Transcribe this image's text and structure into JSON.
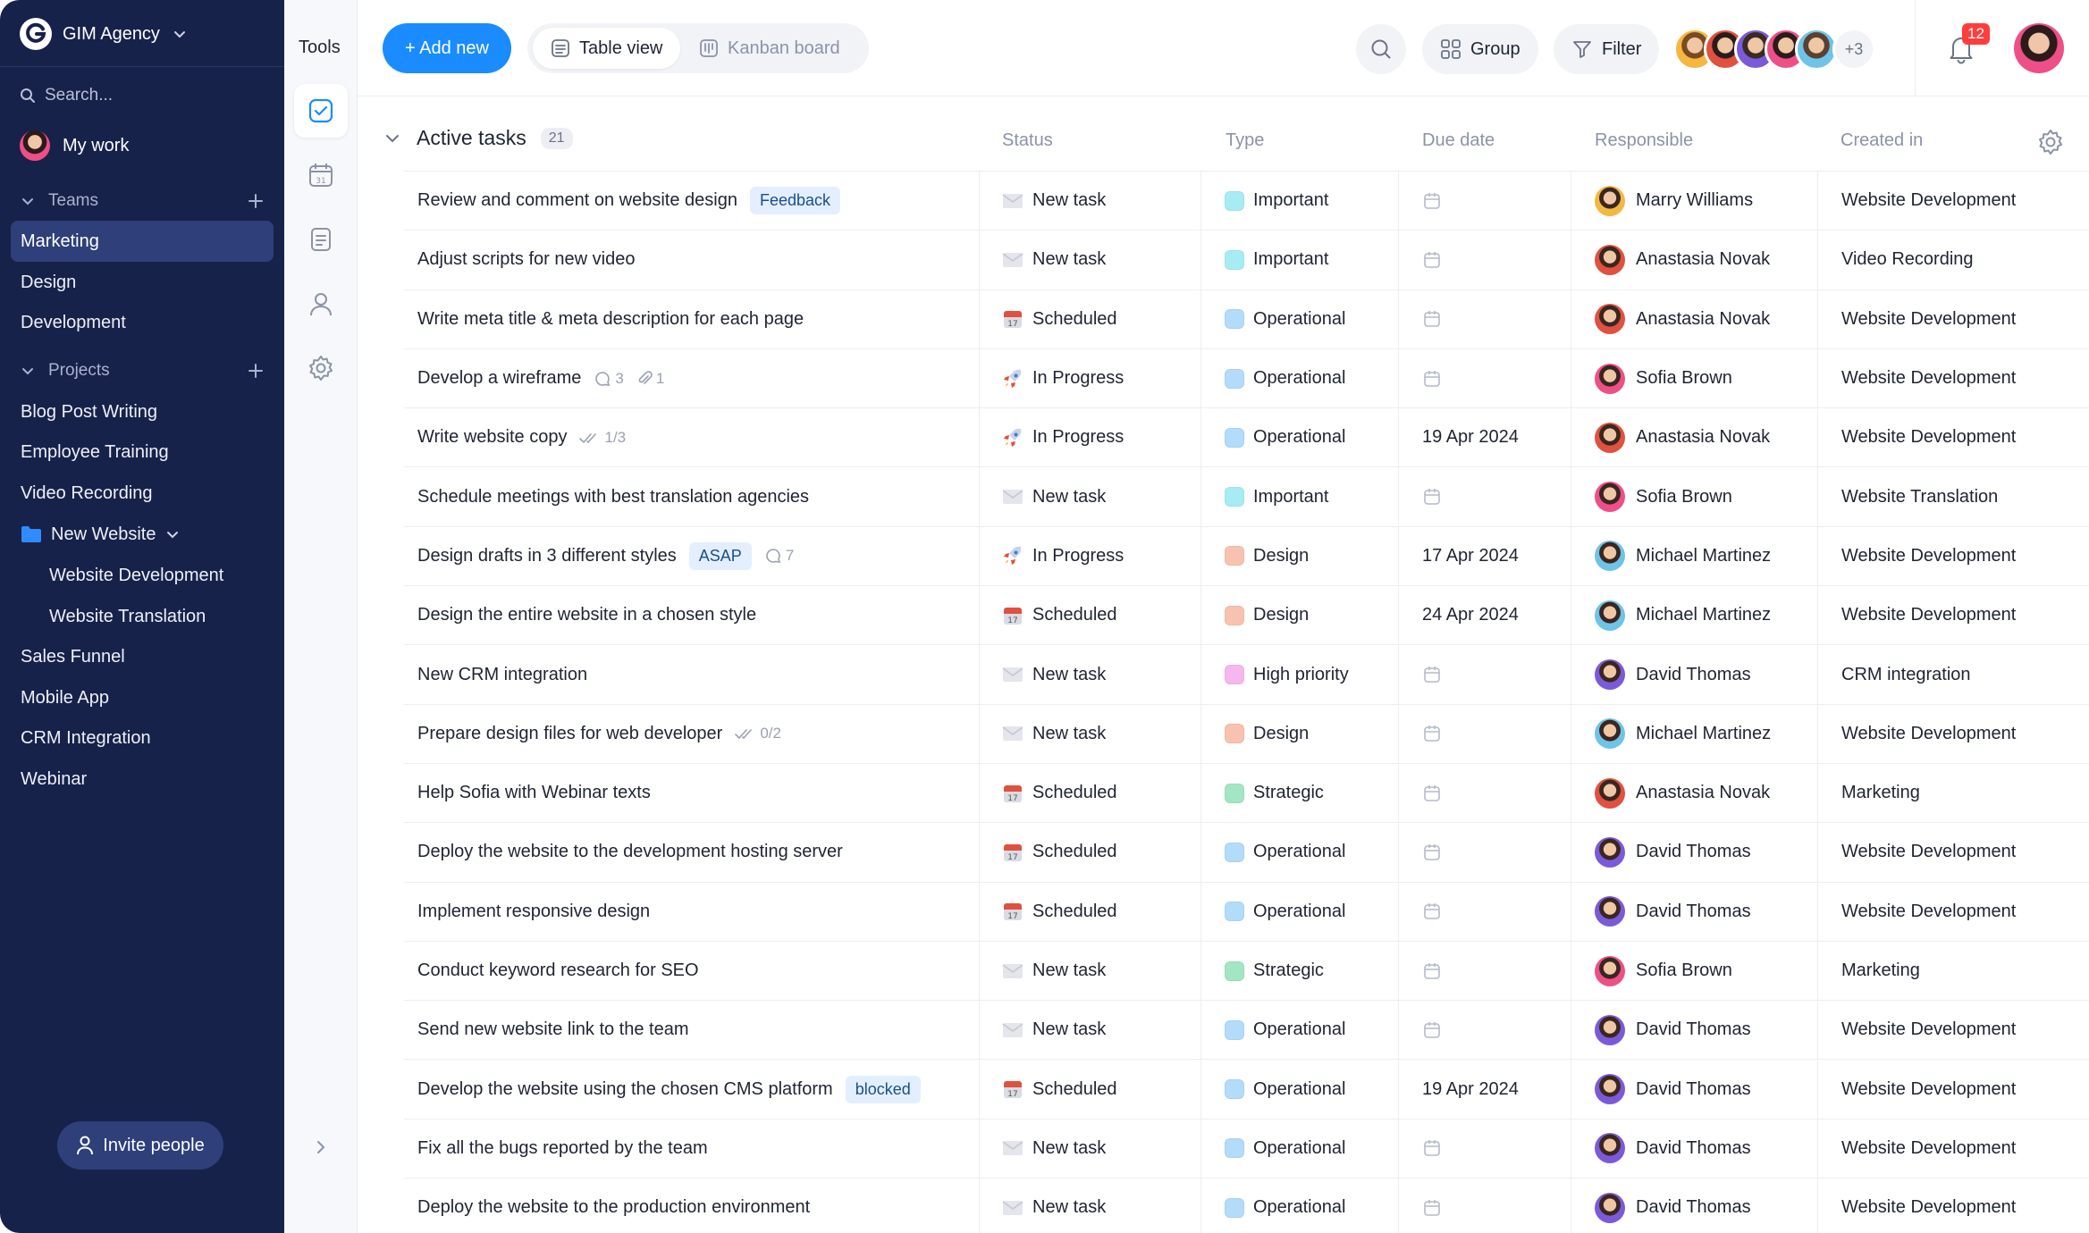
{
  "workspace": {
    "name": "GIM Agency"
  },
  "sidebar": {
    "search_placeholder": "Search...",
    "my_work": "My work",
    "teams_label": "Teams",
    "teams": [
      "Marketing",
      "Design",
      "Development"
    ],
    "active_team": "Marketing",
    "projects_label": "Projects",
    "projects": [
      "Blog Post Writing",
      "Employee Training",
      "Video Recording"
    ],
    "folder": {
      "name": "New Website",
      "children": [
        "Website Development",
        "Website Translation"
      ]
    },
    "projects_after": [
      "Sales Funnel",
      "Mobile App",
      "CRM Integration",
      "Webinar"
    ],
    "invite_label": "Invite people"
  },
  "tools": {
    "title": "Tools"
  },
  "toolbar": {
    "add_label": "+ Add new",
    "table_view": "Table view",
    "kanban_view": "Kanban board",
    "group_label": "Group",
    "filter_label": "Filter",
    "more_members": "+3",
    "notifications": "12"
  },
  "colors": {
    "sidebar_bg": "#17224a",
    "active_item": "#2e3f7a",
    "accent": "#1a8cff",
    "Important": "#a8ecf3",
    "Operational": "#b3dcfb",
    "Design": "#f9c2b0",
    "High priority": "#f5b8ee",
    "Strategic": "#a3e6c3"
  },
  "table": {
    "group_title": "Active tasks",
    "count": "21",
    "columns": {
      "status": "Status",
      "type": "Type",
      "due": "Due date",
      "responsible": "Responsible",
      "created": "Created in"
    },
    "rows": [
      {
        "name": "Review and comment on website design",
        "tag": "Feedback",
        "status": "New task",
        "type": "Important",
        "due": "",
        "responsible": "Marry Williams",
        "avatar": "#f4b740",
        "created": "Website Development"
      },
      {
        "name": "Adjust scripts for new video",
        "status": "New task",
        "type": "Important",
        "due": "",
        "responsible": "Anastasia Novak",
        "avatar": "#e0513f",
        "created": "Video Recording"
      },
      {
        "name": "Write meta title & meta description for each page",
        "status": "Scheduled",
        "type": "Operational",
        "due": "",
        "responsible": "Anastasia Novak",
        "avatar": "#e0513f",
        "created": "Website Development"
      },
      {
        "name": "Develop a wireframe",
        "comments": "3",
        "attachments": "1",
        "status": "In Progress",
        "type": "Operational",
        "due": "",
        "responsible": "Sofia Brown",
        "avatar": "#ee4f86",
        "created": "Website Development"
      },
      {
        "name": "Write website copy",
        "checklist": "1/3",
        "status": "In Progress",
        "type": "Operational",
        "due": "19 Apr 2024",
        "responsible": "Anastasia Novak",
        "avatar": "#e0513f",
        "created": "Website Development"
      },
      {
        "name": "Schedule meetings with best translation agencies",
        "status": "New task",
        "type": "Important",
        "due": "",
        "responsible": "Sofia Brown",
        "avatar": "#ee4f86",
        "created": "Website Translation"
      },
      {
        "name": "Design drafts in 3 different styles",
        "tag": "ASAP",
        "comments": "7",
        "status": "In Progress",
        "type": "Design",
        "due": "17 Apr 2024",
        "responsible": "Michael Martinez",
        "avatar": "#6ec3e8",
        "created": "Website Development"
      },
      {
        "name": "Design the entire website in a chosen style",
        "status": "Scheduled",
        "type": "Design",
        "due": "24 Apr 2024",
        "responsible": "Michael Martinez",
        "avatar": "#6ec3e8",
        "created": "Website Development"
      },
      {
        "name": "New CRM integration",
        "status": "New task",
        "type": "High priority",
        "due": "",
        "responsible": "David Thomas",
        "avatar": "#7b5ad9",
        "created": "CRM integration"
      },
      {
        "name": "Prepare design files for web developer",
        "checklist": "0/2",
        "status": "New task",
        "type": "Design",
        "due": "",
        "responsible": "Michael Martinez",
        "avatar": "#6ec3e8",
        "created": "Website Development"
      },
      {
        "name": "Help Sofia with Webinar texts",
        "status": "Scheduled",
        "type": "Strategic",
        "due": "",
        "responsible": "Anastasia Novak",
        "avatar": "#e0513f",
        "created": "Marketing"
      },
      {
        "name": "Deploy the website to the development hosting server",
        "status": "Scheduled",
        "type": "Operational",
        "due": "",
        "responsible": "David Thomas",
        "avatar": "#7b5ad9",
        "created": "Website Development"
      },
      {
        "name": "Implement responsive design",
        "status": "Scheduled",
        "type": "Operational",
        "due": "",
        "responsible": "David Thomas",
        "avatar": "#7b5ad9",
        "created": "Website Development"
      },
      {
        "name": "Conduct keyword research for SEO",
        "status": "New task",
        "type": "Strategic",
        "due": "",
        "responsible": "Sofia Brown",
        "avatar": "#ee4f86",
        "created": "Marketing"
      },
      {
        "name": "Send new website link to the team",
        "status": "New task",
        "type": "Operational",
        "due": "",
        "responsible": "David Thomas",
        "avatar": "#7b5ad9",
        "created": "Website Development"
      },
      {
        "name": "Develop the website using the chosen CMS platform",
        "tag": "blocked",
        "status": "Scheduled",
        "type": "Operational",
        "due": "19 Apr 2024",
        "responsible": "David Thomas",
        "avatar": "#7b5ad9",
        "created": "Website Development"
      },
      {
        "name": "Fix all the bugs reported by the team",
        "status": "New task",
        "type": "Operational",
        "due": "",
        "responsible": "David Thomas",
        "avatar": "#7b5ad9",
        "created": "Website Development"
      },
      {
        "name": "Deploy the website to the production environment",
        "status": "New task",
        "type": "Operational",
        "due": "",
        "responsible": "David Thomas",
        "avatar": "#7b5ad9",
        "created": "Website Development"
      }
    ]
  }
}
